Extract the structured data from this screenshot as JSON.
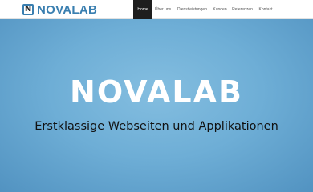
{
  "brand": {
    "logo_letter": "N",
    "name": "NOVALAB",
    "color": "#3a7fb0"
  },
  "nav": {
    "items": [
      {
        "label": "Home",
        "active": true
      },
      {
        "label": "Über uns",
        "active": false
      },
      {
        "label": "Dienstleistungen",
        "active": false
      },
      {
        "label": "Kunden",
        "active": false
      },
      {
        "label": "Referenzen",
        "active": false
      },
      {
        "label": "Kontakt",
        "active": false
      }
    ],
    "active_bg": "#1e1e1e"
  },
  "hero": {
    "title": "NOVALAB",
    "subtitle": "Erstklassige Webseiten und Applikationen",
    "bg_color": "#6eaed6"
  }
}
